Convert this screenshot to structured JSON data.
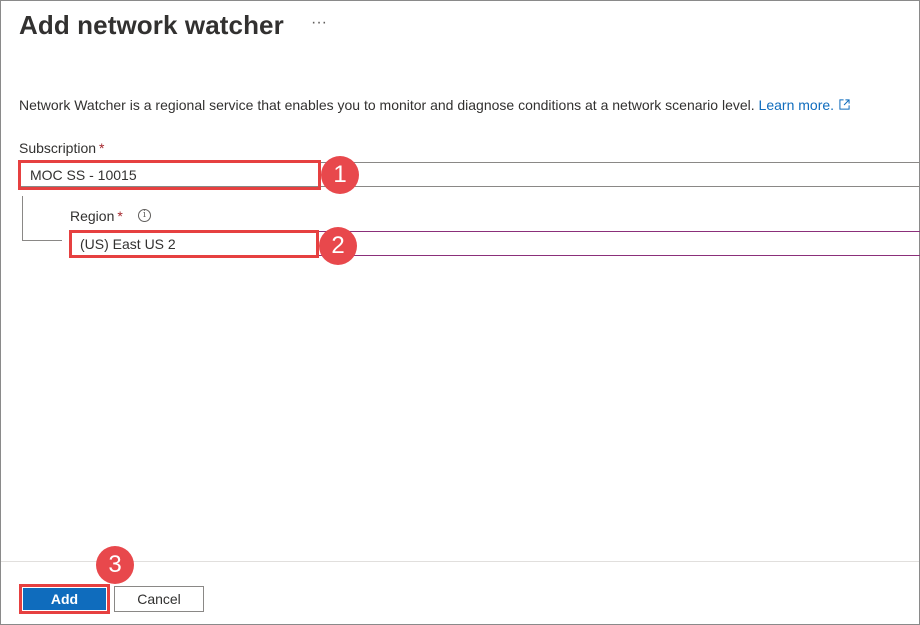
{
  "header": {
    "title": "Add network watcher",
    "more_label": "···"
  },
  "description": {
    "text": "Network Watcher is a regional service that enables you to monitor and diagnose conditions at a network scenario level.",
    "link_text": "Learn more.",
    "link_icon": "external-link-icon"
  },
  "form": {
    "subscription": {
      "label": "Subscription",
      "required_mark": "*",
      "value": "MOC SS - 10015"
    },
    "region": {
      "label": "Region",
      "required_mark": "*",
      "info_icon": "i",
      "value": "(US) East US 2"
    }
  },
  "callouts": [
    "1",
    "2",
    "3"
  ],
  "footer": {
    "add_label": "Add",
    "cancel_label": "Cancel"
  },
  "colors": {
    "accent": "#0f6cbd",
    "highlight": "#e64040",
    "badge": "#e8484c",
    "region_border": "#8b2f7a"
  }
}
